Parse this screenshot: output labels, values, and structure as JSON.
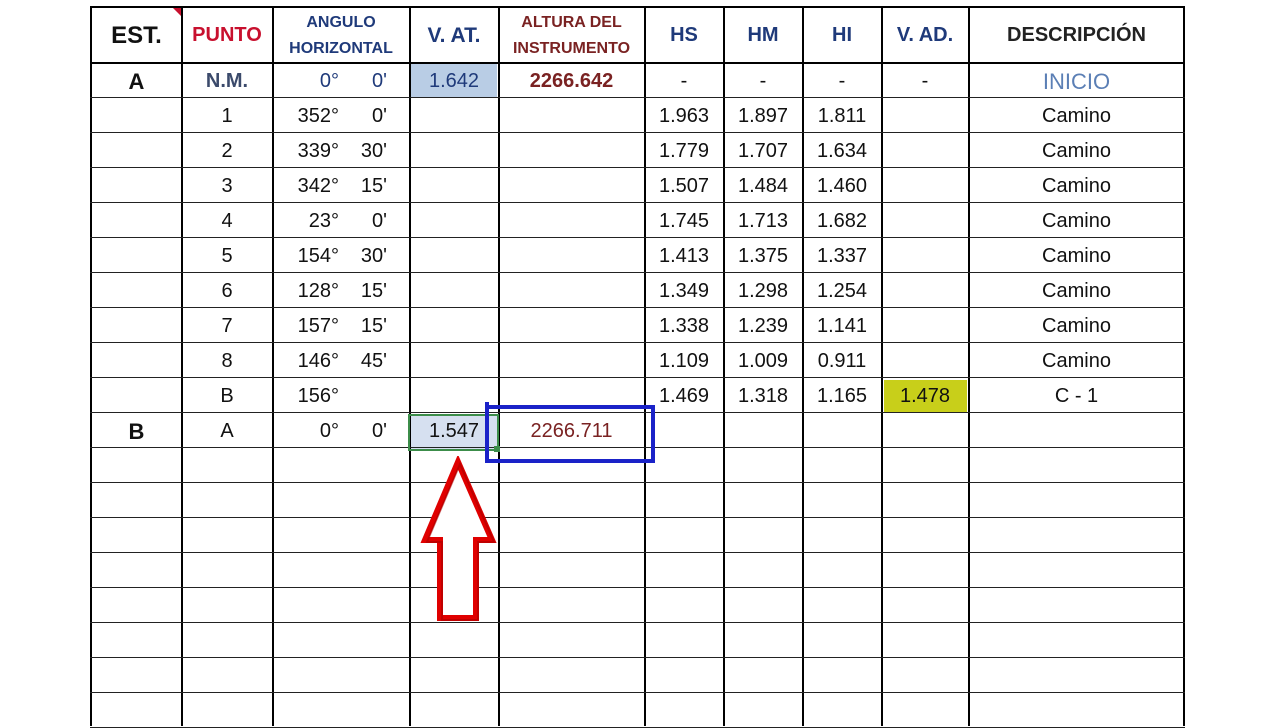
{
  "headers": {
    "est": "EST.",
    "punto": "PUNTO",
    "angulo_line1": "ANGULO",
    "angulo_line2": "HORIZONTAL",
    "v_at": "V. AT.",
    "altura_line1": "ALTURA DEL",
    "altura_line2": "INSTRUMENTO",
    "hs": "HS",
    "hm": "HM",
    "hi": "HI",
    "v_ad": "V. AD.",
    "descripcion": "DESCRIPCIÓN"
  },
  "rows": [
    {
      "est": "A",
      "punto": "N.M.",
      "deg": "0°",
      "min": "0'",
      "v_at": "1.642",
      "altura": "2266.642",
      "hs": "-",
      "hm": "-",
      "hi": "-",
      "v_ad": "-",
      "desc": "INICIO"
    },
    {
      "est": "",
      "punto": "1",
      "deg": "352°",
      "min": "0'",
      "v_at": "",
      "altura": "",
      "hs": "1.963",
      "hm": "1.897",
      "hi": "1.811",
      "v_ad": "",
      "desc": "Camino"
    },
    {
      "est": "",
      "punto": "2",
      "deg": "339°",
      "min": "30'",
      "v_at": "",
      "altura": "",
      "hs": "1.779",
      "hm": "1.707",
      "hi": "1.634",
      "v_ad": "",
      "desc": "Camino"
    },
    {
      "est": "",
      "punto": "3",
      "deg": "342°",
      "min": "15'",
      "v_at": "",
      "altura": "",
      "hs": "1.507",
      "hm": "1.484",
      "hi": "1.460",
      "v_ad": "",
      "desc": "Camino"
    },
    {
      "est": "",
      "punto": "4",
      "deg": "23°",
      "min": "0'",
      "v_at": "",
      "altura": "",
      "hs": "1.745",
      "hm": "1.713",
      "hi": "1.682",
      "v_ad": "",
      "desc": "Camino"
    },
    {
      "est": "",
      "punto": "5",
      "deg": "154°",
      "min": "30'",
      "v_at": "",
      "altura": "",
      "hs": "1.413",
      "hm": "1.375",
      "hi": "1.337",
      "v_ad": "",
      "desc": "Camino"
    },
    {
      "est": "",
      "punto": "6",
      "deg": "128°",
      "min": "15'",
      "v_at": "",
      "altura": "",
      "hs": "1.349",
      "hm": "1.298",
      "hi": "1.254",
      "v_ad": "",
      "desc": "Camino"
    },
    {
      "est": "",
      "punto": "7",
      "deg": "157°",
      "min": "15'",
      "v_at": "",
      "altura": "",
      "hs": "1.338",
      "hm": "1.239",
      "hi": "1.141",
      "v_ad": "",
      "desc": "Camino"
    },
    {
      "est": "",
      "punto": "8",
      "deg": "146°",
      "min": "45'",
      "v_at": "",
      "altura": "",
      "hs": "1.109",
      "hm": "1.009",
      "hi": "0.911",
      "v_ad": "",
      "desc": "Camino"
    },
    {
      "est": "",
      "punto": "B",
      "deg": "156°",
      "min": "",
      "v_at": "",
      "altura": "",
      "hs": "1.469",
      "hm": "1.318",
      "hi": "1.165",
      "v_ad": "1.478",
      "desc": "C - 1"
    },
    {
      "est": "B",
      "punto": "A",
      "deg": "0°",
      "min": "0'",
      "v_at": "1.547",
      "altura": "2266.711",
      "hs": "",
      "hm": "",
      "hi": "",
      "v_ad": "",
      "desc": ""
    }
  ],
  "empty_rows": 8,
  "colors": {
    "punto_header": "#c8102e",
    "blue_header": "#1f3a7a",
    "maroon": "#7a2222",
    "inicio": "#5b7fb5",
    "highlight_blue": "#b9cde5",
    "highlight_yellow": "#c8cf1a",
    "selection_green": "#3c8d4a",
    "annotation_blue": "#1a22c8",
    "annotation_red_arrow": "#e00000"
  },
  "annotations": {
    "arrow": "up-arrow-icon",
    "box": "highlight-box"
  }
}
